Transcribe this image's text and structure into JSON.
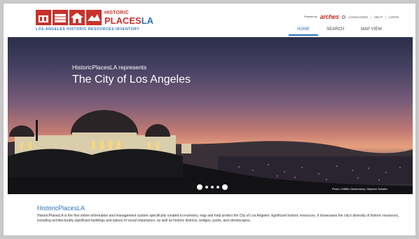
{
  "header": {
    "logo": {
      "historic": "HISTORIC",
      "places": "PLACES",
      "la": "LA",
      "tagline": "LOS ANGELES HISTORIC RESOURCES INVENTORY"
    },
    "utility": {
      "powered_by": "Powered by",
      "arches": "arches",
      "languages": "LANGUAGES",
      "help": "HELP",
      "login": "LOGIN",
      "separator": "|"
    },
    "nav": [
      {
        "label": "HOME",
        "active": true
      },
      {
        "label": "SEARCH",
        "active": false
      },
      {
        "label": "MAP VIEW",
        "active": false
      }
    ]
  },
  "hero": {
    "subtitle": "HistoricPlacesLA represents",
    "title": "The City of Los Angeles",
    "photo_credit": "Photo: Griffith Observatory, Stephen Schafer",
    "slides": {
      "count": 5,
      "active": 5
    }
  },
  "about": {
    "title": "HistoricPlacesLA",
    "body": "HistoricPlacesLA is the first online information and management system specifically created to inventory, map and help protect the City of Los Angeles' significant historic resources. It showcases the city's diversity of historic resources, including architecturally significant buildings and places of social importance, as well as historic districts, bridges, parks, and streetscapes."
  },
  "colors": {
    "brand_red": "#c8322c",
    "brand_blue": "#2c73b8"
  }
}
